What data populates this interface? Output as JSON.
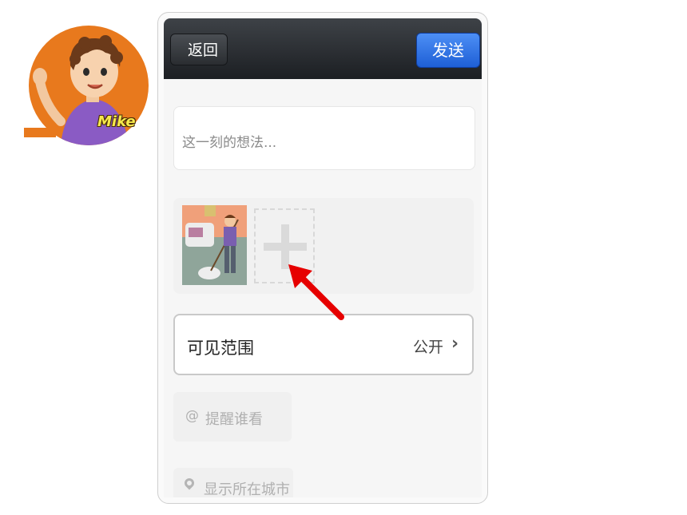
{
  "avatar": {
    "label": "Mike",
    "bg_color": "#e8791d"
  },
  "navbar": {
    "back_label": "返回",
    "send_label": "发送"
  },
  "composer": {
    "placeholder": "这一刻的想法..."
  },
  "photos": {
    "add_icon": "plus-icon"
  },
  "visibility": {
    "label": "可见范围",
    "value": "公开",
    "chevron": "›"
  },
  "remind": {
    "icon": "@",
    "label": "提醒谁看"
  },
  "location": {
    "icon": "location-pin-icon",
    "label": "显示所在城市"
  },
  "annotation": {
    "arrow_color": "#e60000"
  }
}
